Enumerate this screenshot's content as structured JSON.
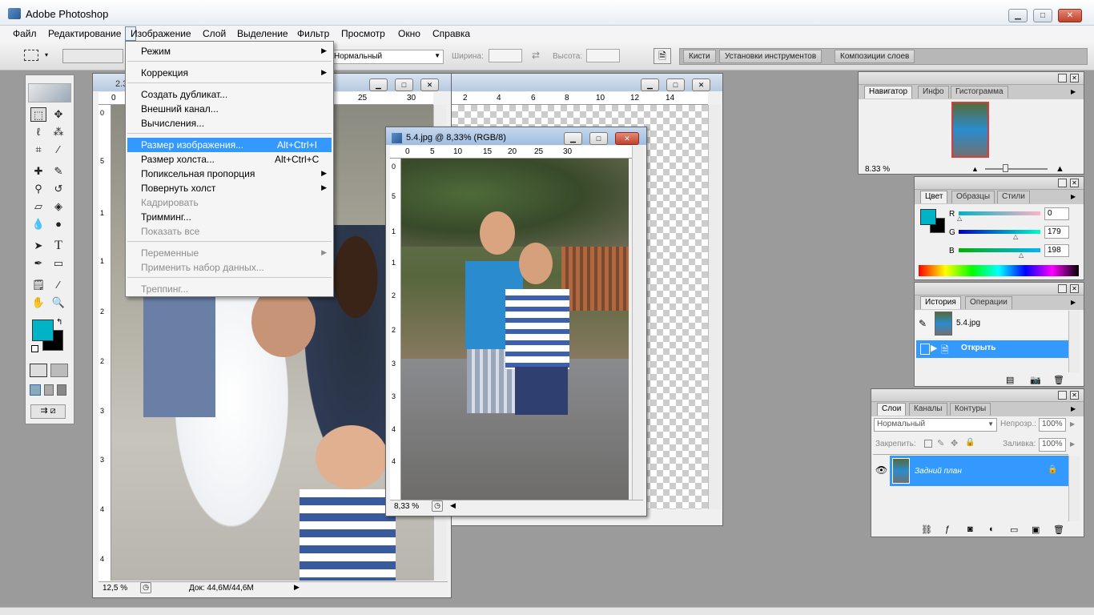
{
  "window": {
    "title": "Adobe Photoshop",
    "btn_min": "▁",
    "btn_max": "□",
    "btn_close": "✕"
  },
  "menu": {
    "items": [
      "Файл",
      "Редактирование",
      "Изображение",
      "Слой",
      "Выделение",
      "Фильтр",
      "Просмотр",
      "Окно",
      "Справка"
    ]
  },
  "options": {
    "mode_value": "Нормальный",
    "width_label": "Ширина:",
    "height_label": "Высота:",
    "well_tabs": [
      "Кисти",
      "Установки инструментов",
      "Композиции слоев"
    ]
  },
  "image_menu": {
    "items": [
      {
        "label": "Режим",
        "shortcut": "",
        "submenu": true,
        "disabled": false
      },
      {
        "label": "Коррекция",
        "shortcut": "",
        "submenu": true,
        "disabled": false
      },
      {
        "label": "Создать дубликат...",
        "shortcut": "",
        "submenu": false,
        "disabled": false
      },
      {
        "label": "Внешний канал...",
        "shortcut": "",
        "submenu": false,
        "disabled": false
      },
      {
        "label": "Вычисления...",
        "shortcut": "",
        "submenu": false,
        "disabled": false
      },
      {
        "label": "Размер изображения...",
        "shortcut": "Alt+Ctrl+I",
        "submenu": false,
        "disabled": false,
        "highlighted": true
      },
      {
        "label": "Размер холста...",
        "shortcut": "Alt+Ctrl+C",
        "submenu": false,
        "disabled": false
      },
      {
        "label": "Попиксельная пропорция",
        "shortcut": "",
        "submenu": true,
        "disabled": false
      },
      {
        "label": "Повернуть холст",
        "shortcut": "",
        "submenu": true,
        "disabled": false
      },
      {
        "label": "Кадрировать",
        "shortcut": "",
        "submenu": false,
        "disabled": true
      },
      {
        "label": "Тримминг...",
        "shortcut": "",
        "submenu": false,
        "disabled": false
      },
      {
        "label": "Показать все",
        "shortcut": "",
        "submenu": false,
        "disabled": true
      },
      {
        "label": "Переменные",
        "shortcut": "",
        "submenu": true,
        "disabled": true
      },
      {
        "label": "Применить набор данных...",
        "shortcut": "",
        "submenu": false,
        "disabled": true
      },
      {
        "label": "Треппинг...",
        "shortcut": "",
        "submenu": false,
        "disabled": true
      }
    ]
  },
  "documents": {
    "doc_back": {
      "title": "2.3",
      "zoom": "12,5 %",
      "info": "Док: 44,6M/44,6M"
    },
    "doc_front": {
      "title": "5.4.jpg @ 8,33% (RGB/8)",
      "zoom": "8,33 %"
    },
    "ruler_back": [
      "0",
      "25",
      "30"
    ],
    "ruler_mid": [
      "2",
      "4",
      "6",
      "8",
      "10",
      "12",
      "14"
    ],
    "ruler_front": [
      "0",
      "5",
      "10",
      "15",
      "20",
      "25",
      "30"
    ],
    "vruler_back": [
      "0",
      "5",
      "1",
      "1",
      "2",
      "2",
      "3",
      "3",
      "4",
      "4",
      "5"
    ],
    "vruler_front": [
      "0",
      "5",
      "1",
      "1",
      "2",
      "2",
      "3",
      "3",
      "4",
      "4",
      "5"
    ]
  },
  "navigator": {
    "tabs": [
      "Навигатор",
      "Инфо",
      "Гистограмма"
    ],
    "zoom": "8.33 %"
  },
  "color_panel": {
    "tabs": [
      "Цвет",
      "Образцы",
      "Стили"
    ],
    "r_label": "R",
    "g_label": "G",
    "b_label": "B",
    "r": "0",
    "g": "179",
    "b": "198",
    "foreground": "#00b3c6"
  },
  "history": {
    "tabs": [
      "История",
      "Операции"
    ],
    "snapshot": "5.4.jpg",
    "step": "Открыть"
  },
  "layers": {
    "tabs": [
      "Слои",
      "Каналы",
      "Контуры"
    ],
    "blend_mode": "Нормальный",
    "opacity_label": "Непрозр.:",
    "opacity": "100%",
    "lock_label": "Закрепить:",
    "fill_label": "Заливка:",
    "fill": "100%",
    "layer_name": "Задний план"
  },
  "colors": {
    "accent": "#3399ff",
    "foreground": "#00b3c6",
    "background": "#000000"
  }
}
